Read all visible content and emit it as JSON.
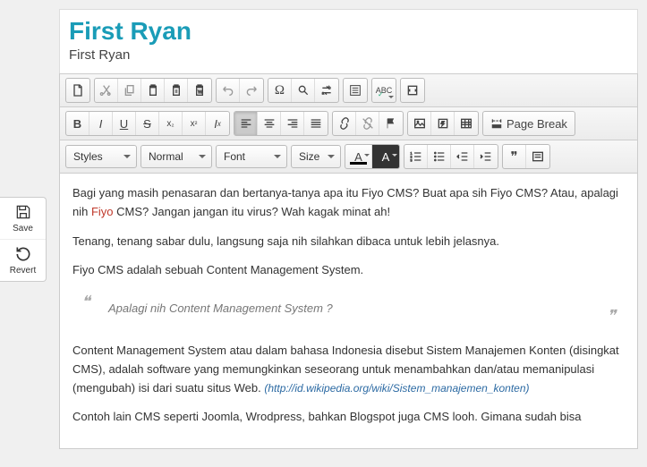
{
  "side": {
    "save": "Save",
    "revert": "Revert"
  },
  "header": {
    "title": "First Ryan",
    "subtitle": "First Ryan"
  },
  "toolbar": {
    "styles": "Styles",
    "format": "Normal",
    "font": "Font",
    "size": "Size",
    "pagebreak": "Page Break",
    "abc": "ABC"
  },
  "content": {
    "p1a": "Bagi yang masih penasaran dan bertanya-tanya apa itu Fiyo CMS? Buat apa sih Fiyo CMS? Atau, apalagi nih ",
    "p1b": "Fiyo",
    "p1c": " CMS? Jangan jangan itu virus? Wah kagak minat ah!",
    "p2": "Tenang, tenang sabar dulu, langsung saja nih silahkan dibaca untuk lebih jelasnya.",
    "p3": "Fiyo CMS adalah sebuah Content Management System.",
    "quote": "Apalagi nih Content Management System ?",
    "p4a": "Content Management System atau dalam bahasa Indonesia disebut Sistem Manajemen Konten (disingkat CMS), adalah software yang memungkinkan seseorang untuk menambahkan dan/atau memanipulasi (mengubah) isi dari suatu situs Web. ",
    "p4link": "(http://id.wikipedia.org/wiki/Sistem_manajemen_konten)",
    "p5": "Contoh lain CMS seperti Joomla, Wrodpress, bahkan Blogspot juga CMS looh. Gimana sudah bisa"
  }
}
